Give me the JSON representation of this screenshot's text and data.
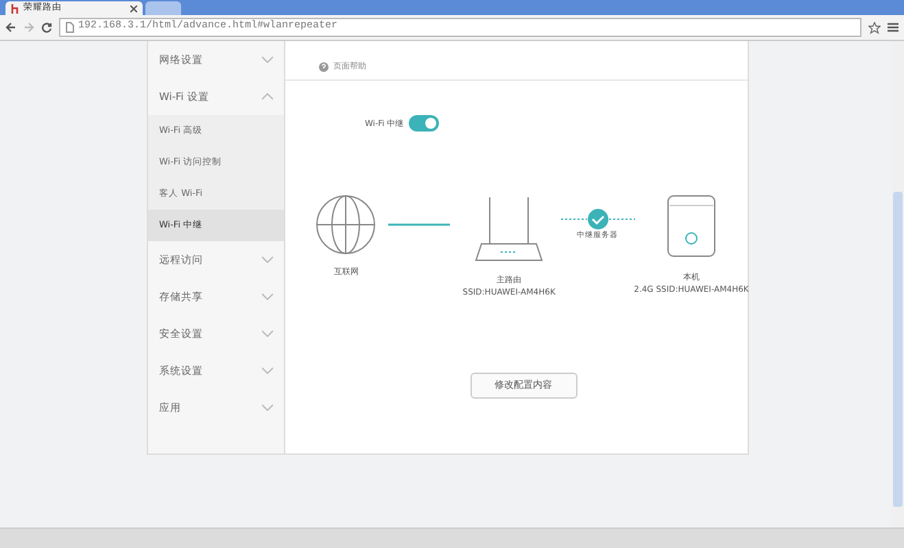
{
  "browser": {
    "tabs": [
      {
        "title": "荣耀路由",
        "selected": true
      },
      {
        "selected": false
      }
    ],
    "url": "192.168.3.1/html/advance.html#wlanrepeater"
  },
  "sidebar": {
    "items": [
      {
        "kind": "group",
        "label": "网络设置",
        "expanded": false
      },
      {
        "kind": "group",
        "label": "Wi-Fi 设置",
        "expanded": true
      },
      {
        "kind": "sub",
        "label": "Wi-Fi 高级",
        "selected": false
      },
      {
        "kind": "sub",
        "label": "Wi-Fi 访问控制",
        "selected": false
      },
      {
        "kind": "sub",
        "label": "客人 Wi-Fi",
        "selected": false
      },
      {
        "kind": "sub",
        "label": "Wi-Fi 中继",
        "selected": true
      },
      {
        "kind": "group",
        "label": "远程访问",
        "expanded": false
      },
      {
        "kind": "group",
        "label": "存储共享",
        "expanded": false
      },
      {
        "kind": "group",
        "label": "安全设置",
        "expanded": false
      },
      {
        "kind": "group",
        "label": "系统设置",
        "expanded": false
      },
      {
        "kind": "group",
        "label": "应用",
        "expanded": false
      }
    ]
  },
  "help_link": "页面帮助",
  "repeater": {
    "label": "Wi-Fi 中继",
    "on": true
  },
  "diagram": {
    "internet": "互联网",
    "main_router": {
      "name": "主路由",
      "ssid": "SSID:HUAWEI-AM4H6K"
    },
    "link_status": "中继服务器",
    "local": {
      "name": "本机",
      "ssid": "2.4G SSID:HUAWEI-AM4H6K"
    }
  },
  "button": "修改配置内容"
}
